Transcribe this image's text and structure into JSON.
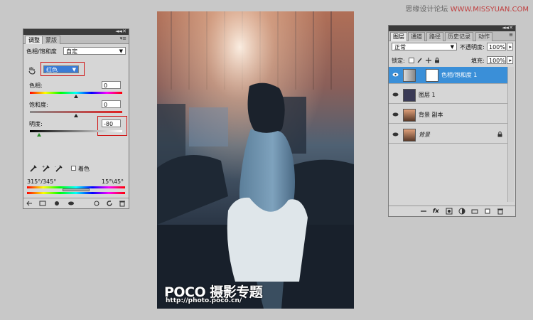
{
  "watermark": {
    "text": "思缘设计论坛",
    "site": "WWW.MISSYUAN.COM"
  },
  "adjustments": {
    "tabs": [
      "调整",
      "蒙版"
    ],
    "preset_label": "色相/饱和度",
    "preset_value": "自定",
    "channel_value": "红色",
    "hue_label": "色相:",
    "hue_value": "0",
    "hue_level": 0.5,
    "saturation_label": "饱和度:",
    "saturation_value": "0",
    "saturation_level": 0.5,
    "lightness_label": "明度:",
    "lightness_value": "-80",
    "lightness_level": 0.1,
    "colorize_label": "着色",
    "range_left": "315°/345°",
    "range_right": "15°\\45°"
  },
  "photo": {
    "logo": "POCO 摄影专题",
    "url": "http://photo.poco.cn/"
  },
  "layers": {
    "tabs": [
      "图层",
      "通道",
      "路径",
      "历史记录",
      "动作"
    ],
    "blend_mode": "正常",
    "opacity_label": "不透明度:",
    "opacity_value": "100%",
    "lock_label": "锁定:",
    "fill_label": "填充:",
    "fill_value": "100%",
    "items": [
      {
        "name": "色相/饱和度 1"
      },
      {
        "name": "图层 1"
      },
      {
        "name": "背景 副本"
      },
      {
        "name": "背景"
      }
    ]
  },
  "colors": {
    "selection": "#3a8fd8",
    "highlight_box": "#d01010",
    "background": "#c8c8c8"
  }
}
